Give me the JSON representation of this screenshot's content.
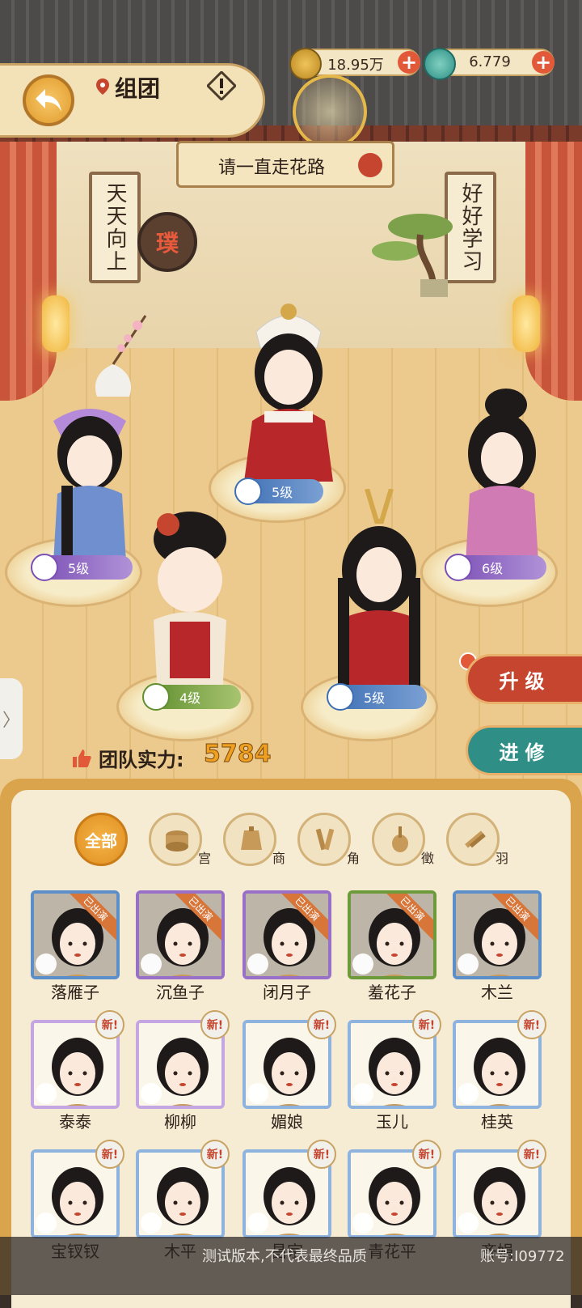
{
  "header": {
    "title": "组团",
    "currency": [
      {
        "icon": "coin-icon",
        "value": "18.95万"
      },
      {
        "icon": "jade-icon",
        "value": "6.779"
      }
    ]
  },
  "stage": {
    "team_name": "请一直走花路",
    "banner_left": "天天向上",
    "banner_right": "好好学习",
    "seal_text": "璞",
    "members": [
      {
        "name": "落雁子",
        "level": "5级",
        "class": "blue"
      },
      {
        "name": "沉鱼子",
        "level": "5级",
        "class": "purple"
      },
      {
        "name": "闭月子",
        "level": "6级",
        "class": "purple"
      },
      {
        "name": "羞花子",
        "level": "4级",
        "class": "green"
      },
      {
        "name": "木兰",
        "level": "5级",
        "class": "blue"
      }
    ],
    "team_power_label": "团队实力:",
    "team_power_value": "5784",
    "upgrade_label": "升级",
    "study_label": "进修",
    "side_handle": "〉"
  },
  "filters": [
    {
      "label": "全部",
      "icon": ""
    },
    {
      "label": "宫",
      "icon": "drum-icon"
    },
    {
      "label": "商",
      "icon": "bell-icon"
    },
    {
      "label": "角",
      "icon": "clapper-icon"
    },
    {
      "label": "徵",
      "icon": "pipa-icon"
    },
    {
      "label": "羽",
      "icon": "flute-icon"
    }
  ],
  "roster": {
    "performing_label": "已出演",
    "new_label": "新!",
    "rows": [
      [
        {
          "name": "落雁子",
          "frame": "blue",
          "performing": true
        },
        {
          "name": "沉鱼子",
          "frame": "purple",
          "performing": true
        },
        {
          "name": "闭月子",
          "frame": "purple",
          "performing": true
        },
        {
          "name": "羞花子",
          "frame": "green",
          "performing": true
        },
        {
          "name": "木兰",
          "frame": "blue",
          "performing": true
        }
      ],
      [
        {
          "name": "泰泰",
          "frame": "lp",
          "new": true
        },
        {
          "name": "柳柳",
          "frame": "lp",
          "new": true
        },
        {
          "name": "媚娘",
          "frame": "lb",
          "new": true
        },
        {
          "name": "玉儿",
          "frame": "lb",
          "new": true
        },
        {
          "name": "桂英",
          "frame": "lb",
          "new": true
        }
      ],
      [
        {
          "name": "宝钗钗",
          "frame": "lb",
          "new": true
        },
        {
          "name": "木平",
          "frame": "lb",
          "new": true
        },
        {
          "name": "昌宗",
          "frame": "lb",
          "new": true
        },
        {
          "name": "青花平",
          "frame": "lb",
          "new": true
        },
        {
          "name": "齐娟",
          "frame": "lb",
          "new": true
        }
      ]
    ]
  },
  "footer": {
    "notice": "测试版本,不代表最终品质",
    "account": "账号:I09772"
  },
  "colors": {
    "accent_red": "#c5452f",
    "accent_teal": "#2f8f86",
    "gold": "#e09a2a",
    "power_value": "#f0a020"
  }
}
